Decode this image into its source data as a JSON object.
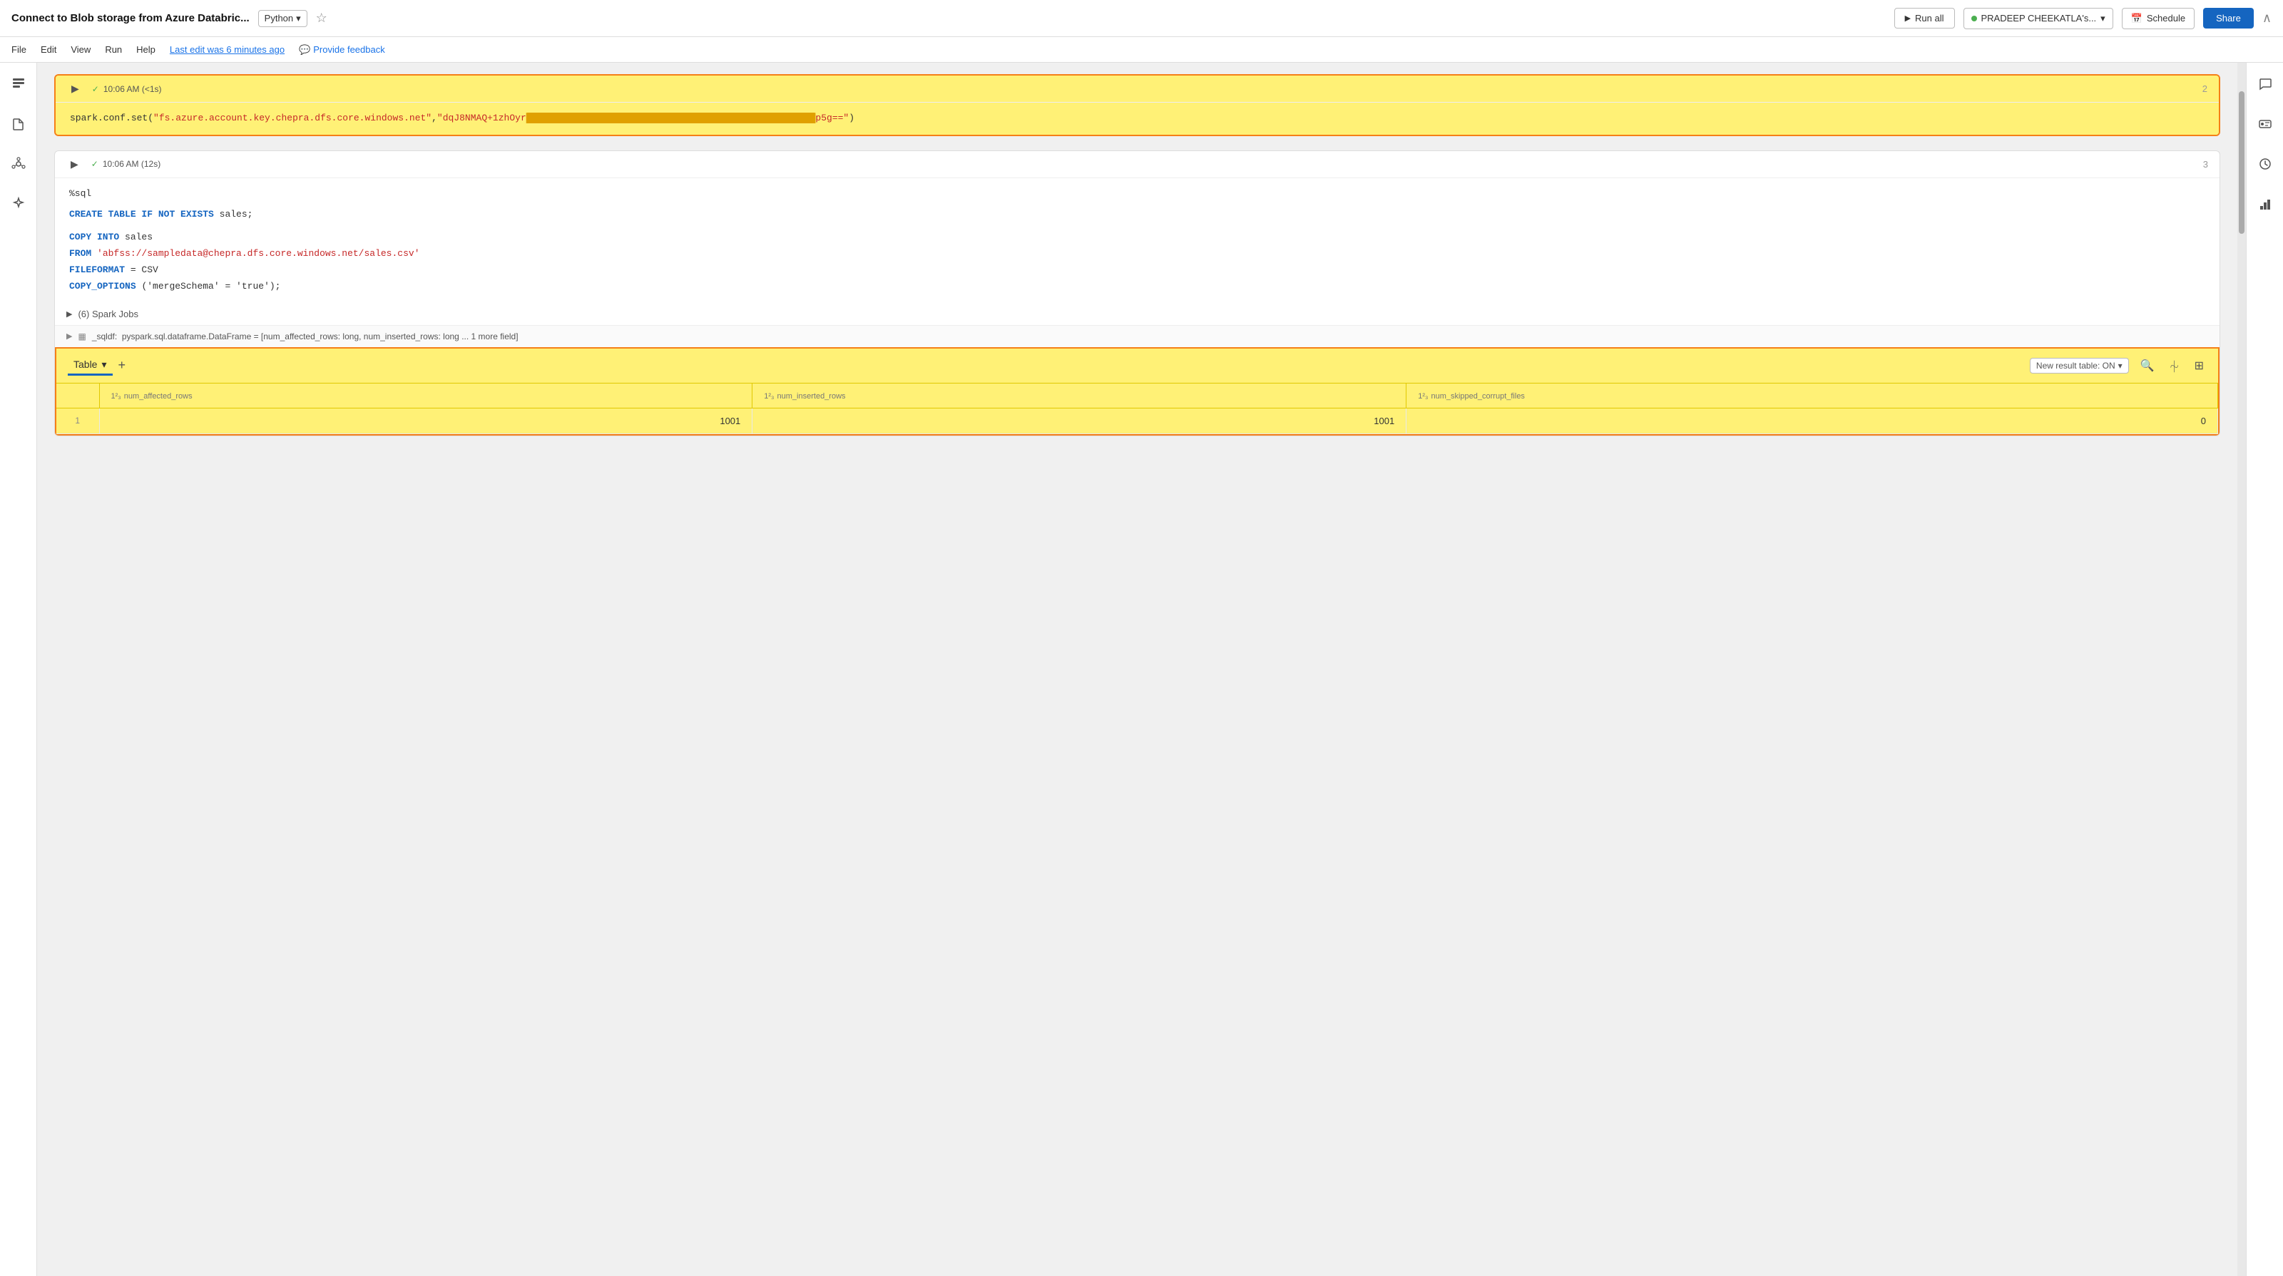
{
  "topbar": {
    "title": "Connect to Blob storage from Azure Databric...",
    "language": "Python",
    "run_all_label": "Run all",
    "user_label": "PRADEEP CHEEKATLA's...",
    "schedule_label": "Schedule",
    "share_label": "Share"
  },
  "menubar": {
    "items": [
      "File",
      "Edit",
      "View",
      "Run",
      "Help"
    ],
    "last_edit": "Last edit was 6 minutes ago",
    "feedback": "Provide feedback"
  },
  "cells": [
    {
      "id": "cell-2",
      "number": "2",
      "status": "10:06 AM (<1s)",
      "highlighted": true,
      "code": "spark.conf.set(\"fs.azure.account.key.chepra.dfs.core.windows.net\",\"dqJ8NMAQ+1zhOyr████████████████████████████████████████████████p5g==\")"
    },
    {
      "id": "cell-3",
      "number": "3",
      "status": "10:06 AM (12s)",
      "highlighted": false,
      "spark_jobs": "(6) Spark Jobs",
      "result_info": "_sqldf:  pyspark.sql.dataframe.DataFrame = [num_affected_rows: long, num_inserted_rows: long ... 1 more field]",
      "code_lines": [
        {
          "type": "normal",
          "text": "%sql"
        },
        {
          "type": "sql",
          "parts": [
            {
              "kw": "CREATE",
              "color": "kw-sql"
            },
            {
              "kw": " TABLE IF NOT EXISTS ",
              "color": "kw-sql"
            },
            {
              "kw": "sales;",
              "color": "kw-normal"
            }
          ]
        },
        {
          "type": "blank"
        },
        {
          "type": "sql2",
          "parts": [
            {
              "kw": "COPY INTO ",
              "color": "kw-sql"
            },
            {
              "kw": "sales",
              "color": "kw-normal"
            }
          ]
        },
        {
          "type": "sql2",
          "parts": [
            {
              "kw": "FROM ",
              "color": "kw-sql"
            },
            {
              "kw": "'abfss://sampledata@chepra.dfs.core.windows.net/sales.csv'",
              "color": "kw-string"
            }
          ]
        },
        {
          "type": "sql2",
          "parts": [
            {
              "kw": "FILEFORMAT",
              "color": "kw-sql"
            },
            {
              "kw": " = CSV",
              "color": "kw-normal"
            }
          ]
        },
        {
          "type": "sql2",
          "parts": [
            {
              "kw": "COPY_OPTIONS",
              "color": "kw-sql"
            },
            {
              "kw": " ('mergeSchema' = 'true');",
              "color": "kw-normal"
            }
          ]
        }
      ]
    }
  ],
  "table_result": {
    "tab_label": "Table",
    "add_tab_label": "+",
    "new_result_label": "New result table: ON",
    "columns": [
      {
        "name": "num_affected_rows",
        "type": "1²₃"
      },
      {
        "name": "num_inserted_rows",
        "type": "1²₃"
      },
      {
        "name": "num_skipped_corrupt_files",
        "type": "1²₃"
      }
    ],
    "rows": [
      {
        "row_num": "1",
        "col1": "1001",
        "col2": "1001",
        "col3": "0"
      }
    ]
  },
  "sidebar_left": {
    "icons": [
      "≡",
      "📁",
      "⬡",
      "✦"
    ]
  },
  "sidebar_right": {
    "icons": [
      "💬",
      "⬣",
      "⏰",
      "⚙",
      "📊"
    ]
  }
}
